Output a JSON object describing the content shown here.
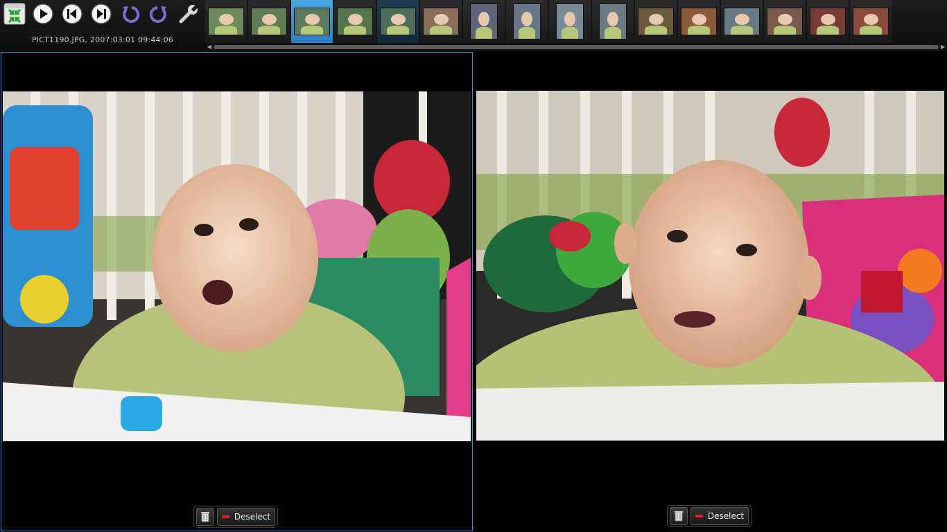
{
  "toolbar": {
    "buttons": [
      {
        "name": "fullscreen-exit-icon"
      },
      {
        "name": "play-icon"
      },
      {
        "name": "previous-icon"
      },
      {
        "name": "next-icon"
      },
      {
        "name": "rotate-left-icon"
      },
      {
        "name": "rotate-right-icon"
      },
      {
        "name": "tools-wrench-icon"
      }
    ],
    "filename": "PICT1190.JPG, 2007:03:01 09:44:06"
  },
  "filmstrip": {
    "thumbnails": [
      {
        "orientation": "land",
        "tone": "#6f8a5a",
        "state": "normal"
      },
      {
        "orientation": "land",
        "tone": "#5f7d55",
        "state": "normal"
      },
      {
        "orientation": "land",
        "tone": "#5c7a60",
        "state": "selected"
      },
      {
        "orientation": "land",
        "tone": "#55734f",
        "state": "normal"
      },
      {
        "orientation": "land",
        "tone": "#4d6d5a",
        "state": "secondary"
      },
      {
        "orientation": "land",
        "tone": "#8a6d5a",
        "state": "normal"
      },
      {
        "orientation": "port",
        "tone": "#5d6478",
        "state": "normal"
      },
      {
        "orientation": "port",
        "tone": "#6b7488",
        "state": "normal"
      },
      {
        "orientation": "port",
        "tone": "#7a8a96",
        "state": "normal"
      },
      {
        "orientation": "port",
        "tone": "#6e7a82",
        "state": "normal"
      },
      {
        "orientation": "land",
        "tone": "#6a5a40",
        "state": "normal"
      },
      {
        "orientation": "land",
        "tone": "#8a5a3a",
        "state": "normal"
      },
      {
        "orientation": "land",
        "tone": "#6a7a84",
        "state": "normal"
      },
      {
        "orientation": "land",
        "tone": "#7a5a4a",
        "state": "normal"
      },
      {
        "orientation": "land",
        "tone": "#7a3a3a",
        "state": "normal"
      },
      {
        "orientation": "land",
        "tone": "#8a4a3a",
        "state": "normal"
      }
    ]
  },
  "panes": {
    "left": {
      "deselect_label": "Deselect",
      "active": true
    },
    "right": {
      "deselect_label": "Deselect",
      "active": false
    }
  },
  "colors": {
    "accent": "#4aa6e6",
    "pane_border": "#4a8ccc",
    "deselect_minus": "#e02020"
  }
}
